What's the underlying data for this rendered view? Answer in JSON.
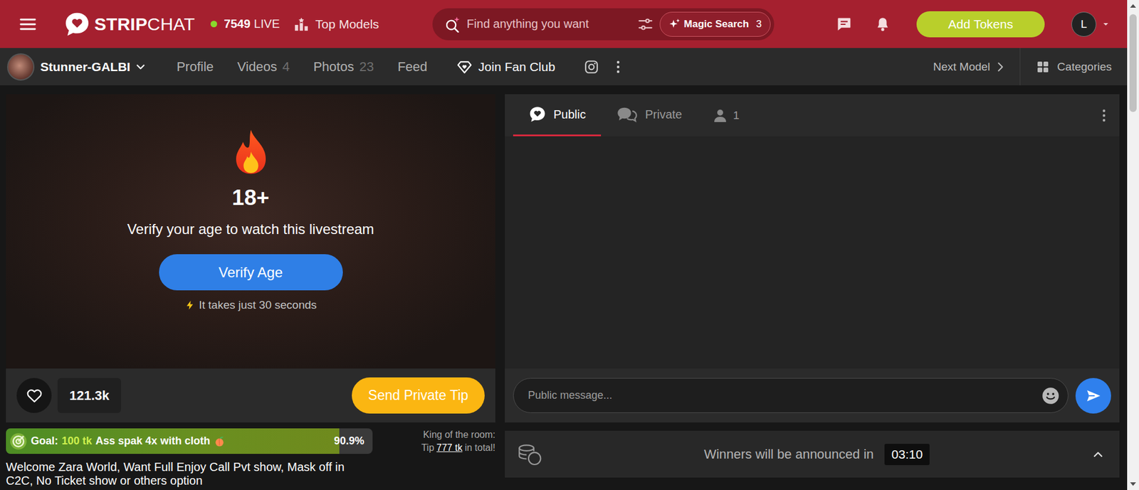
{
  "header": {
    "logo": {
      "bold": "STRIP",
      "light": "CHAT"
    },
    "live": {
      "count": "7549",
      "label": "LIVE"
    },
    "top_models": "Top Models",
    "search": {
      "placeholder": "Find anything you want"
    },
    "magic_search": {
      "label": "Magic Search",
      "count": "3"
    },
    "add_tokens": "Add Tokens",
    "avatar": "L"
  },
  "model_bar": {
    "name": "Stunner-GALBI",
    "nav": [
      {
        "label": "Profile",
        "count": "",
        "selected": false
      },
      {
        "label": "Videos",
        "count": "4",
        "selected": false
      },
      {
        "label": "Photos",
        "count": "23",
        "selected": false
      },
      {
        "label": "Feed",
        "count": "",
        "selected": false
      }
    ],
    "fan_club": "Join Fan Club",
    "next_model": "Next Model",
    "categories": "Categories"
  },
  "stream": {
    "age_badge": "18+",
    "message": "Verify your age to watch this livestream",
    "button": "Verify Age",
    "hint": "It takes just 30 seconds",
    "likes": "121.3k",
    "tip_button": "Send Private Tip"
  },
  "goal": {
    "label": "Goal:",
    "amount": "100 tk",
    "text": "Ass spak 4x with cloth",
    "percent": "90.9%",
    "level": 0.909
  },
  "king": {
    "title": "King of the room:",
    "prefix": "Tip",
    "amount": "777 tk",
    "suffix": "in total!"
  },
  "description": "Welcome Zara World, Want Full Enjoy Call Pvt show, Mask off in C2C, No Ticket show or others option",
  "chat": {
    "tabs": [
      {
        "label": "Public",
        "selected": true
      },
      {
        "label": "Private",
        "selected": false
      }
    ],
    "users": "1",
    "input_placeholder": "Public message...",
    "winners": {
      "text": "Winners will be announced in",
      "time": "03:10"
    }
  }
}
